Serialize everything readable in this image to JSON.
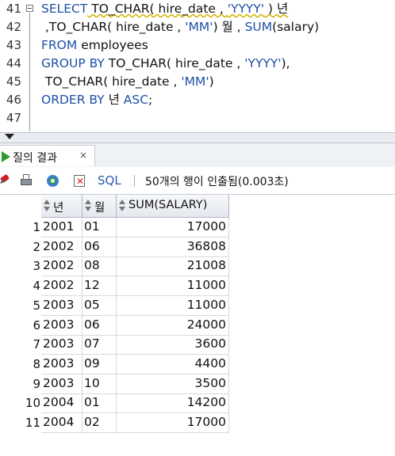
{
  "editor": {
    "lines": [
      {
        "no": "41",
        "tokens": [
          {
            "t": "SELECT",
            "c": "kw"
          },
          {
            "t": " TO_CHAR( hire_date , ",
            "c": "sq"
          },
          {
            "t": "'YYYY'",
            "c": "str sq"
          },
          {
            "t": " ) 년",
            "c": "sq"
          }
        ]
      },
      {
        "no": "42",
        "tokens": [
          {
            "t": " ,TO_CHAR( hire_date , ",
            "c": ""
          },
          {
            "t": "'MM'",
            "c": "str"
          },
          {
            "t": ") 월 , ",
            "c": ""
          },
          {
            "t": "SUM",
            "c": "kw"
          },
          {
            "t": "(salary)",
            "c": ""
          }
        ]
      },
      {
        "no": "43",
        "tokens": [
          {
            "t": "FROM",
            "c": "kw"
          },
          {
            "t": " employees",
            "c": ""
          }
        ]
      },
      {
        "no": "44",
        "tokens": [
          {
            "t": "GROUP BY",
            "c": "kw"
          },
          {
            "t": " TO_CHAR( hire_date , ",
            "c": ""
          },
          {
            "t": "'YYYY'",
            "c": "str"
          },
          {
            "t": "),",
            "c": ""
          }
        ]
      },
      {
        "no": "45",
        "tokens": [
          {
            "t": " TO_CHAR( hire_date , ",
            "c": ""
          },
          {
            "t": "'MM'",
            "c": "str"
          },
          {
            "t": ")",
            "c": ""
          }
        ]
      },
      {
        "no": "46",
        "tokens": [
          {
            "t": "ORDER BY",
            "c": "kw"
          },
          {
            "t": " 년 ",
            "c": ""
          },
          {
            "t": "ASC",
            "c": "kw"
          },
          {
            "t": ";",
            "c": ""
          }
        ]
      },
      {
        "no": "47",
        "tokens": []
      }
    ]
  },
  "results_tab": {
    "label": "질의 결과",
    "close": "×"
  },
  "toolbar": {
    "icons": [
      "pin-icon",
      "print-icon",
      "refresh-icon",
      "delete-icon"
    ],
    "sql_label": "SQL",
    "separator": "|",
    "status": "50개의 행이 인출됨(0.003초)"
  },
  "table": {
    "columns": [
      "년",
      "월",
      "SUM(SALARY)"
    ],
    "rows": [
      {
        "n": "1",
        "year": "2001",
        "month": "01",
        "sum": "17000"
      },
      {
        "n": "2",
        "year": "2002",
        "month": "06",
        "sum": "36808"
      },
      {
        "n": "3",
        "year": "2002",
        "month": "08",
        "sum": "21008"
      },
      {
        "n": "4",
        "year": "2002",
        "month": "12",
        "sum": "11000"
      },
      {
        "n": "5",
        "year": "2003",
        "month": "05",
        "sum": "11000"
      },
      {
        "n": "6",
        "year": "2003",
        "month": "06",
        "sum": "24000"
      },
      {
        "n": "7",
        "year": "2003",
        "month": "07",
        "sum": "3600"
      },
      {
        "n": "8",
        "year": "2003",
        "month": "09",
        "sum": "4400"
      },
      {
        "n": "9",
        "year": "2003",
        "month": "10",
        "sum": "3500"
      },
      {
        "n": "10",
        "year": "2004",
        "month": "01",
        "sum": "14200"
      },
      {
        "n": "11",
        "year": "2004",
        "month": "02",
        "sum": "17000"
      }
    ]
  }
}
